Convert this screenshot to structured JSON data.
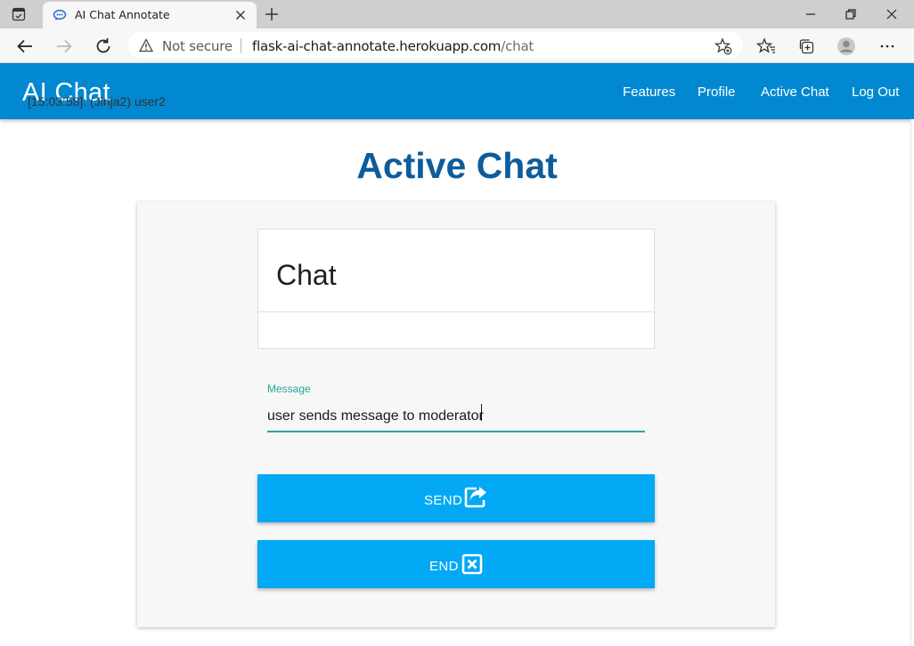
{
  "browser": {
    "tab_title": "AI Chat Annotate",
    "security_label": "Not secure",
    "url_host": "flask-ai-chat-annotate.herokuapp.com",
    "url_path": "/chat"
  },
  "navbar": {
    "brand": "AI Chat",
    "links": [
      "Features",
      "Profile",
      "Active Chat",
      "Log Out"
    ]
  },
  "page": {
    "title": "Active Chat"
  },
  "chat": {
    "title": "Chat",
    "messages": [
      "[15:03:58]: (Jinja2) user2"
    ]
  },
  "message_form": {
    "label": "Message",
    "value": "user sends message to moderator"
  },
  "buttons": {
    "send": "SEND",
    "end": "END"
  },
  "colors": {
    "navbar": "#0288d1",
    "title": "#0d5c9c",
    "button": "#03a9f4",
    "input_accent": "#26a69a"
  }
}
